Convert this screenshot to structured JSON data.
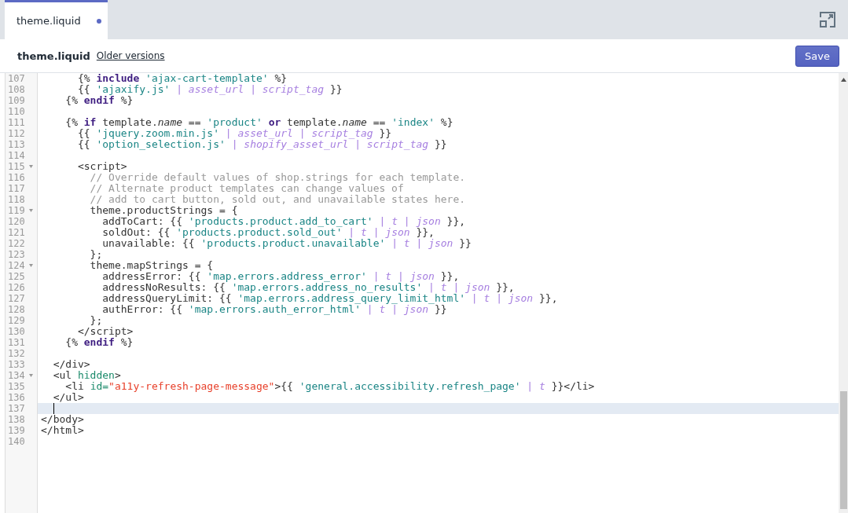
{
  "tab": {
    "label": "theme.liquid",
    "selected": true,
    "modified": true
  },
  "header": {
    "title": "theme.liquid",
    "link": "Older versions",
    "save": "Save"
  },
  "lines": [
    {
      "number": "107",
      "foldable": false,
      "active": false,
      "tokens": [
        {
          "kind": "plain",
          "text": "      {% "
        },
        {
          "kind": "keyword",
          "text": "include"
        },
        {
          "kind": "string",
          "text": " 'ajax-cart-template'"
        },
        {
          "kind": "plain",
          "text": " %}"
        }
      ]
    },
    {
      "number": "108",
      "foldable": false,
      "active": false,
      "tokens": [
        {
          "kind": "plain",
          "text": "      {{ "
        },
        {
          "kind": "string",
          "text": "'ajaxify.js'"
        },
        {
          "kind": "pipe",
          "text": " | "
        },
        {
          "kind": "filter",
          "text": "asset_url"
        },
        {
          "kind": "pipe",
          "text": " | "
        },
        {
          "kind": "filter",
          "text": "script_tag"
        },
        {
          "kind": "plain",
          "text": " }}"
        }
      ]
    },
    {
      "number": "109",
      "foldable": false,
      "active": false,
      "tokens": [
        {
          "kind": "plain",
          "text": "    {% "
        },
        {
          "kind": "keyword",
          "text": "endif"
        },
        {
          "kind": "plain",
          "text": " %}"
        }
      ]
    },
    {
      "number": "110",
      "foldable": false,
      "active": false
    },
    {
      "number": "111",
      "foldable": false,
      "active": false,
      "tokens": [
        {
          "kind": "plain",
          "text": "    {% "
        },
        {
          "kind": "keyword",
          "text": "if"
        },
        {
          "kind": "plain",
          "text": " template."
        },
        {
          "kind": "property",
          "text": "name"
        },
        {
          "kind": "plain",
          "text": " == "
        },
        {
          "kind": "string",
          "text": "'product'"
        },
        {
          "kind": "keyword",
          "text": " or"
        },
        {
          "kind": "plain",
          "text": " template."
        },
        {
          "kind": "property",
          "text": "name"
        },
        {
          "kind": "plain",
          "text": " == "
        },
        {
          "kind": "string",
          "text": "'index'"
        },
        {
          "kind": "plain",
          "text": " %}"
        }
      ]
    },
    {
      "number": "112",
      "foldable": false,
      "active": false,
      "tokens": [
        {
          "kind": "plain",
          "text": "      {{ "
        },
        {
          "kind": "string",
          "text": "'jquery.zoom.min.js'"
        },
        {
          "kind": "pipe",
          "text": " | "
        },
        {
          "kind": "filter",
          "text": "asset_url"
        },
        {
          "kind": "pipe",
          "text": " | "
        },
        {
          "kind": "filter",
          "text": "script_tag"
        },
        {
          "kind": "plain",
          "text": " }}"
        }
      ]
    },
    {
      "number": "113",
      "foldable": false,
      "active": false,
      "tokens": [
        {
          "kind": "plain",
          "text": "      {{ "
        },
        {
          "kind": "string",
          "text": "'option_selection.js'"
        },
        {
          "kind": "pipe",
          "text": " | "
        },
        {
          "kind": "filter",
          "text": "shopify_asset_url"
        },
        {
          "kind": "pipe",
          "text": " | "
        },
        {
          "kind": "filter",
          "text": "script_tag"
        },
        {
          "kind": "plain",
          "text": " }}"
        }
      ]
    },
    {
      "number": "114",
      "foldable": false,
      "active": false
    },
    {
      "number": "115",
      "foldable": true,
      "active": false,
      "tokens": [
        {
          "kind": "tag",
          "text": "      <script>"
        }
      ]
    },
    {
      "number": "116",
      "foldable": false,
      "active": false,
      "tokens": [
        {
          "kind": "comment",
          "text": "        // Override default values of shop.strings for each template."
        }
      ]
    },
    {
      "number": "117",
      "foldable": false,
      "active": false,
      "tokens": [
        {
          "kind": "comment",
          "text": "        // Alternate product templates can change values of"
        }
      ]
    },
    {
      "number": "118",
      "foldable": false,
      "active": false,
      "tokens": [
        {
          "kind": "comment",
          "text": "        // add to cart button, sold out, and unavailable states here."
        }
      ]
    },
    {
      "number": "119",
      "foldable": true,
      "active": false,
      "tokens": [
        {
          "kind": "plain",
          "text": "        theme.productStrings = {"
        }
      ]
    },
    {
      "number": "120",
      "foldable": false,
      "active": false,
      "tokens": [
        {
          "kind": "plain",
          "text": "          addToCart: {{ "
        },
        {
          "kind": "string",
          "text": "'products.product.add_to_cart'"
        },
        {
          "kind": "pipe",
          "text": " | "
        },
        {
          "kind": "filter",
          "text": "t"
        },
        {
          "kind": "pipe",
          "text": " | "
        },
        {
          "kind": "filter",
          "text": "json"
        },
        {
          "kind": "plain",
          "text": " }},"
        }
      ]
    },
    {
      "number": "121",
      "foldable": false,
      "active": false,
      "tokens": [
        {
          "kind": "plain",
          "text": "          soldOut: {{ "
        },
        {
          "kind": "string",
          "text": "'products.product.sold_out'"
        },
        {
          "kind": "pipe",
          "text": " | "
        },
        {
          "kind": "filter",
          "text": "t"
        },
        {
          "kind": "pipe",
          "text": " | "
        },
        {
          "kind": "filter",
          "text": "json"
        },
        {
          "kind": "plain",
          "text": " }},"
        }
      ]
    },
    {
      "number": "122",
      "foldable": false,
      "active": false,
      "tokens": [
        {
          "kind": "plain",
          "text": "          unavailable: {{ "
        },
        {
          "kind": "string",
          "text": "'products.product.unavailable'"
        },
        {
          "kind": "pipe",
          "text": " | "
        },
        {
          "kind": "filter",
          "text": "t"
        },
        {
          "kind": "pipe",
          "text": " | "
        },
        {
          "kind": "filter",
          "text": "json"
        },
        {
          "kind": "plain",
          "text": " }}"
        }
      ]
    },
    {
      "number": "123",
      "foldable": false,
      "active": false,
      "tokens": [
        {
          "kind": "plain",
          "text": "        };"
        }
      ]
    },
    {
      "number": "124",
      "foldable": true,
      "active": false,
      "tokens": [
        {
          "kind": "plain",
          "text": "        theme.mapStrings = {"
        }
      ]
    },
    {
      "number": "125",
      "foldable": false,
      "active": false,
      "tokens": [
        {
          "kind": "plain",
          "text": "          addressError: {{ "
        },
        {
          "kind": "string",
          "text": "'map.errors.address_error'"
        },
        {
          "kind": "pipe",
          "text": " | "
        },
        {
          "kind": "filter",
          "text": "t"
        },
        {
          "kind": "pipe",
          "text": " | "
        },
        {
          "kind": "filter",
          "text": "json"
        },
        {
          "kind": "plain",
          "text": " }},"
        }
      ]
    },
    {
      "number": "126",
      "foldable": false,
      "active": false,
      "tokens": [
        {
          "kind": "plain",
          "text": "          addressNoResults: {{ "
        },
        {
          "kind": "string",
          "text": "'map.errors.address_no_results'"
        },
        {
          "kind": "pipe",
          "text": " | "
        },
        {
          "kind": "filter",
          "text": "t"
        },
        {
          "kind": "pipe",
          "text": " | "
        },
        {
          "kind": "filter",
          "text": "json"
        },
        {
          "kind": "plain",
          "text": " }},"
        }
      ]
    },
    {
      "number": "127",
      "foldable": false,
      "active": false,
      "tokens": [
        {
          "kind": "plain",
          "text": "          addressQueryLimit: {{ "
        },
        {
          "kind": "string",
          "text": "'map.errors.address_query_limit_html'"
        },
        {
          "kind": "pipe",
          "text": " | "
        },
        {
          "kind": "filter",
          "text": "t"
        },
        {
          "kind": "pipe",
          "text": " | "
        },
        {
          "kind": "filter",
          "text": "json"
        },
        {
          "kind": "plain",
          "text": " }},"
        }
      ]
    },
    {
      "number": "128",
      "foldable": false,
      "active": false,
      "tokens": [
        {
          "kind": "plain",
          "text": "          authError: {{ "
        },
        {
          "kind": "string",
          "text": "'map.errors.auth_error_html'"
        },
        {
          "kind": "pipe",
          "text": " | "
        },
        {
          "kind": "filter",
          "text": "t"
        },
        {
          "kind": "pipe",
          "text": " | "
        },
        {
          "kind": "filter",
          "text": "json"
        },
        {
          "kind": "plain",
          "text": " }}"
        }
      ]
    },
    {
      "number": "129",
      "foldable": false,
      "active": false,
      "tokens": [
        {
          "kind": "plain",
          "text": "        };"
        }
      ]
    },
    {
      "number": "130",
      "foldable": false,
      "active": false,
      "tokens": [
        {
          "kind": "tag",
          "text": "      </script>"
        }
      ]
    },
    {
      "number": "131",
      "foldable": false,
      "active": false,
      "tokens": [
        {
          "kind": "plain",
          "text": "    {% "
        },
        {
          "kind": "keyword",
          "text": "endif"
        },
        {
          "kind": "plain",
          "text": " %}"
        }
      ]
    },
    {
      "number": "132",
      "foldable": false,
      "active": false
    },
    {
      "number": "133",
      "foldable": false,
      "active": false,
      "tokens": [
        {
          "kind": "tag",
          "text": "  </div>"
        }
      ]
    },
    {
      "number": "134",
      "foldable": true,
      "active": false,
      "tokens": [
        {
          "kind": "tag",
          "text": "  <ul "
        },
        {
          "kind": "attribute",
          "text": "hidden"
        },
        {
          "kind": "tag",
          "text": ">"
        }
      ]
    },
    {
      "number": "135",
      "foldable": false,
      "active": false,
      "tokens": [
        {
          "kind": "tag",
          "text": "    <li "
        },
        {
          "kind": "attribute",
          "text": "id="
        },
        {
          "kind": "value",
          "text": "\"a11y-refresh-page-message\""
        },
        {
          "kind": "tag",
          "text": ">"
        },
        {
          "kind": "plain",
          "text": "{{ "
        },
        {
          "kind": "string",
          "text": "'general.accessibility.refresh_page'"
        },
        {
          "kind": "pipe",
          "text": " | "
        },
        {
          "kind": "filter",
          "text": "t"
        },
        {
          "kind": "plain",
          "text": " }}"
        },
        {
          "kind": "tag",
          "text": "</li>"
        }
      ]
    },
    {
      "number": "136",
      "foldable": false,
      "active": false,
      "tokens": [
        {
          "kind": "tag",
          "text": "  </ul>"
        }
      ]
    },
    {
      "number": "137",
      "foldable": false,
      "active": true
    },
    {
      "number": "138",
      "foldable": false,
      "active": false,
      "tokens": [
        {
          "kind": "tag",
          "text": "</body>"
        }
      ]
    },
    {
      "number": "139",
      "foldable": false,
      "active": false,
      "tokens": [
        {
          "kind": "tag",
          "text": "</html>"
        }
      ]
    },
    {
      "number": "140",
      "foldable": false,
      "active": false
    }
  ]
}
